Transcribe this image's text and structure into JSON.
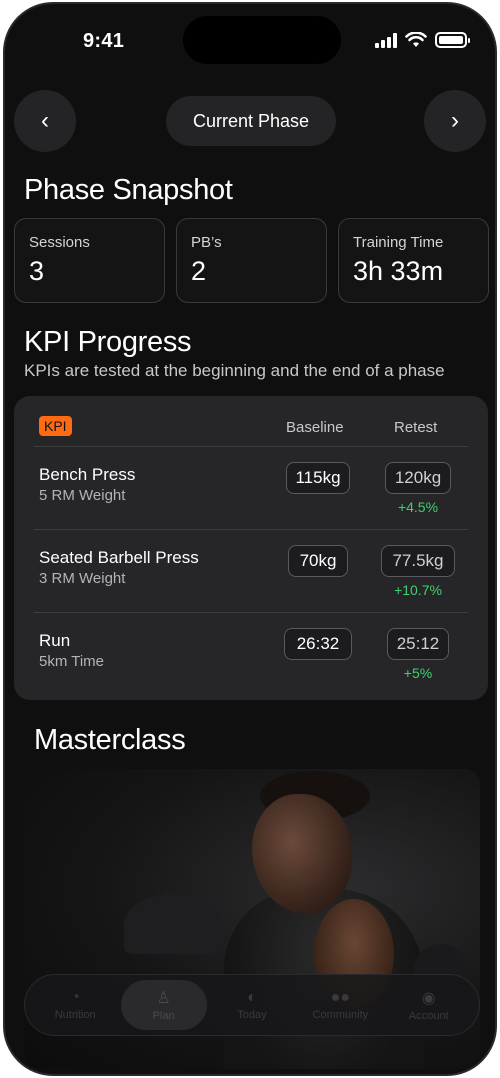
{
  "status_bar": {
    "time": "9:41"
  },
  "phase_nav": {
    "prev_icon": "‹",
    "next_icon": "›",
    "label": "Current Phase"
  },
  "snapshot": {
    "title": "Phase Snapshot",
    "stats": [
      {
        "label": "Sessions",
        "value": "3"
      },
      {
        "label": "PB’s",
        "value": "2"
      },
      {
        "label": "Training Time",
        "value": "3h 33m"
      }
    ]
  },
  "kpi": {
    "title": "KPI Progress",
    "subtitle": "KPIs are tested at the beginning and the end of a phase",
    "tag": "KPI",
    "col_baseline": "Baseline",
    "col_retest": "Retest",
    "rows": [
      {
        "name": "Bench Press",
        "metric": "5 RM Weight",
        "baseline": "115kg",
        "retest": "120kg",
        "delta": "+4.5%"
      },
      {
        "name": "Seated Barbell Press",
        "metric": "3 RM Weight",
        "baseline": "70kg",
        "retest": "77.5kg",
        "delta": "+10.7%"
      },
      {
        "name": "Run",
        "metric": "5km Time",
        "baseline": "26:32",
        "retest": "25:12",
        "delta": "+5%"
      }
    ]
  },
  "masterclass": {
    "title": "Masterclass"
  },
  "tabbar": {
    "tabs": [
      {
        "label": "Nutrition",
        "icon": "pie-chart-icon"
      },
      {
        "label": "Plan",
        "icon": "person-icon"
      },
      {
        "label": "Today",
        "icon": "logo-icon"
      },
      {
        "label": "Community",
        "icon": "people-icon"
      },
      {
        "label": "Account",
        "icon": "account-icon"
      }
    ]
  },
  "colors": {
    "accent": "#ff6a13",
    "positive": "#3fd06b",
    "background": "#0f0f10",
    "card": "#262628"
  }
}
